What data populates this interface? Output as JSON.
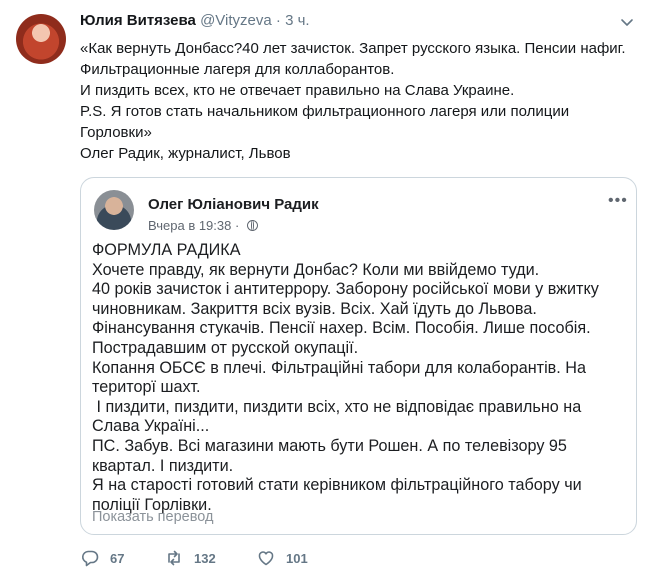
{
  "tweet": {
    "name": "Юлия Витязева",
    "handle": "@Vityzeva",
    "separator": "·",
    "time": "3 ч.",
    "lines": [
      "«Как вернуть Донбасс?40 лет зачисток. Запрет русского языка. Пенсии нафиг.",
      "Фильтрационные лагеря для коллаборантов.",
      "И пиздить всех, кто не отвечает правильно на Слава Украине.",
      "P.S. Я готов стать начальником фильтрационного лагеря или полиции",
      "Горловки»",
      "Олег Радик, журналист, Львов"
    ]
  },
  "quoted": {
    "name": "Олег Юліанович Радик",
    "time": "Вчера в 19:38",
    "separator": "·",
    "more": "•••",
    "lines": [
      "ФОРМУЛА РАДИКА",
      "Хочете правду, як вернути Донбас? Коли ми ввійдемо туди.",
      "40 років зачисток і антитеррору. Заборону російської мови у вжитку",
      "чиновникам. Закриття всіх вузів. Всіх. Хай їдуть до Львова.",
      "Фінансування стукачів. Пенсії нахер. Всім. Пособія. Лише пособія.",
      "Пострадавшим от русской окупації.",
      "Копання ОБСЄ в плечі. Фільтраційні табори для колаборантів. На",
      "територї шахт.",
      " І пиздити, пиздити, пиздити всіх, хто не відповідає правильно на",
      "Слава Україні...",
      "ПС. Забув. Всі магазини мають бути Рошен. А по телевізору 95",
      "квартал. І пиздити.",
      "Я на старості готовий стати керівником фільтраційного табору чи",
      "поліції Горлівки."
    ],
    "translate": "Показать перевод"
  },
  "actions": {
    "replies": "67",
    "retweets": "132",
    "likes": "101"
  }
}
